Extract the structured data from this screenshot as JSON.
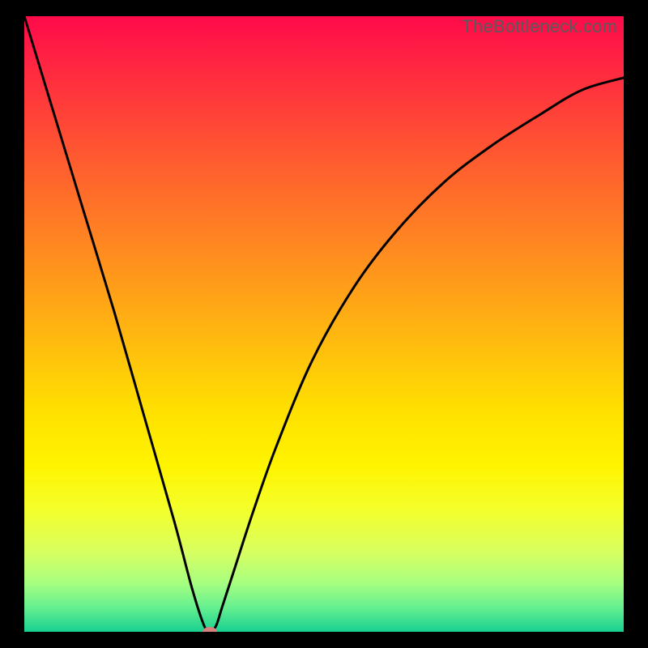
{
  "watermark": "TheBottleneck.com",
  "chart_data": {
    "type": "line",
    "title": "",
    "xlabel": "",
    "ylabel": "",
    "xlim": [
      0,
      100
    ],
    "ylim": [
      0,
      100
    ],
    "series": [
      {
        "name": "bottleneck-curve",
        "x": [
          0,
          5,
          10,
          15,
          20,
          25,
          28,
          30,
          31,
          32,
          33,
          35,
          38,
          42,
          48,
          55,
          62,
          70,
          78,
          86,
          93,
          100
        ],
        "y": [
          100,
          84,
          68,
          52,
          35,
          18,
          7,
          1,
          0,
          1,
          4,
          10,
          19,
          30,
          44,
          56,
          65,
          73,
          79,
          84,
          88,
          90
        ]
      }
    ],
    "marker": {
      "name": "minimum-point",
      "x": 31,
      "y": 0
    },
    "background": {
      "type": "vertical-gradient",
      "stops": [
        {
          "pos": 0.0,
          "color": "#ff0a4a"
        },
        {
          "pos": 0.5,
          "color": "#ffc400"
        },
        {
          "pos": 0.8,
          "color": "#f4ff2a"
        },
        {
          "pos": 1.0,
          "color": "#18d090"
        }
      ]
    }
  }
}
